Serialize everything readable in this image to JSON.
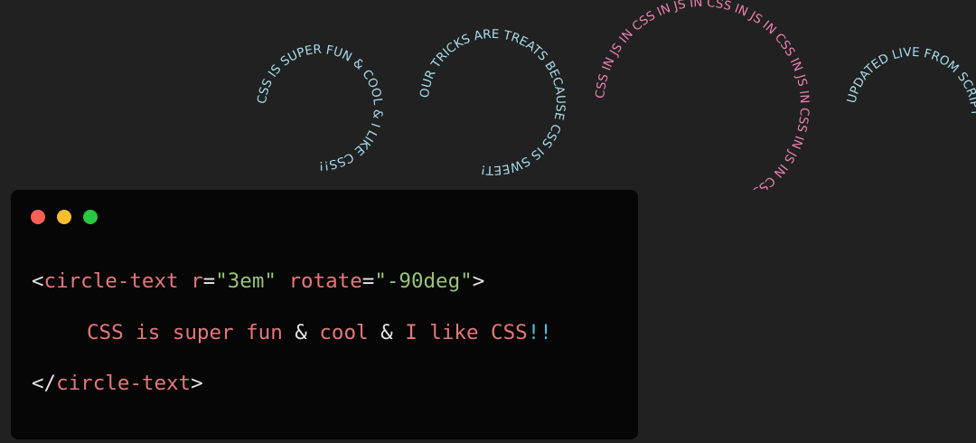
{
  "circle_texts": [
    {
      "text": "CSS IS SUPER FUN & COOL & I LIKE CSS!!",
      "color": "#a6dcec"
    },
    {
      "text": "OUR TRICKS ARE TREATS BECAUSE CSS IS SWEET!",
      "color": "#a6dcec"
    },
    {
      "text": "CSS IN JS IN CSS IN JS IN CSS IN JS IN CSS IN JS IN CSS IN JS IN CSS IN JS IN",
      "color": "#ef7fb2"
    },
    {
      "text": "UPDATED LIVE FROM SCRIPT",
      "color": "#a6dcec"
    }
  ],
  "window_controls": {
    "close": "#ff5f57",
    "minimize": "#febc2e",
    "maximize": "#28c840"
  },
  "code": {
    "line1": {
      "open_bracket": "<",
      "tag": "circle-text",
      "attr1_name": " r",
      "eq1": "=",
      "attr1_value": "\"3em\"",
      "attr2_name": " rotate",
      "eq2": "=",
      "attr2_value": "\"-90deg\"",
      "close_bracket": ">"
    },
    "line2": {
      "part1": "CSS is super fun",
      "amp1": " & ",
      "part2": "cool",
      "amp2": " & ",
      "part3": "I like CSS",
      "bangs": "!!"
    },
    "line3": {
      "open_bracket": "</",
      "tag": "circle-text",
      "close_bracket": ">"
    }
  }
}
